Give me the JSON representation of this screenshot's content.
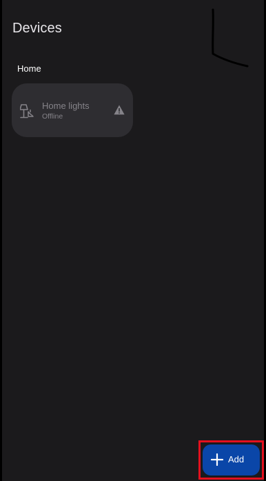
{
  "header": {
    "title": "Devices"
  },
  "section": {
    "label": "Home"
  },
  "device": {
    "name": "Home lights",
    "status": "Offline",
    "icon": "lamp-icon",
    "status_icon": "warning-icon"
  },
  "fab": {
    "label": "Add",
    "icon": "plus-icon"
  },
  "colors": {
    "background": "#1b1a1c",
    "card": "#2e2d31",
    "muted_text": "#858389",
    "fab": "#0a46a8",
    "highlight": "#e3101e"
  }
}
